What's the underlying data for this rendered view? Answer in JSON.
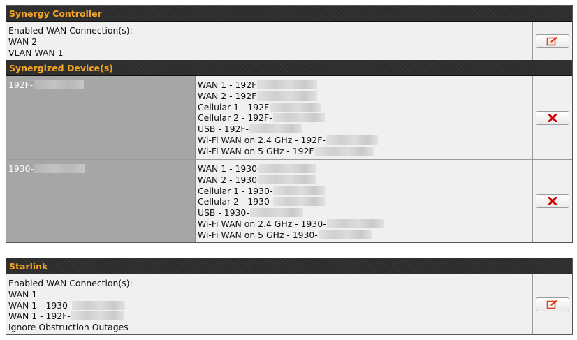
{
  "synergy_controller": {
    "title": "Synergy Controller",
    "lines": [
      "Enabled WAN Connection(s):",
      "WAN 2",
      "VLAN WAN 1"
    ]
  },
  "synergized_devices": {
    "title": "Synergized Device(s)",
    "devices": [
      {
        "name": "192F-",
        "connections": [
          "WAN 1 - 192F",
          "WAN 2 - 192F",
          "Cellular 1 - 192F",
          "Cellular 2 - 192F-",
          "USB - 192F-",
          "Wi-Fi WAN on 2.4 GHz - 192F-",
          "Wi-Fi WAN on 5 GHz - 192F"
        ]
      },
      {
        "name": "1930-",
        "connections": [
          "WAN 1 - 1930",
          "WAN 2 - 1930",
          "Cellular 1 - 1930-",
          "Cellular 2 - 1930-",
          "USB - 1930-",
          "Wi-Fi WAN on 2.4 GHz - 1930-",
          "Wi-Fi WAN on 5 GHz - 1930-"
        ]
      }
    ]
  },
  "starlink": {
    "title": "Starlink",
    "lines": [
      "Enabled WAN Connection(s):",
      "WAN 1",
      "WAN 1 - 1930-",
      "WAN 1 - 192F-",
      "Ignore Obstruction Outages"
    ]
  },
  "icons": {
    "edit": "edit-icon",
    "delete": "delete-icon"
  },
  "colors": {
    "header_text": "#f5a623",
    "header_bg": "#2c2c2c",
    "delete_red": "#d40000",
    "edit_orange": "#e0421c"
  }
}
